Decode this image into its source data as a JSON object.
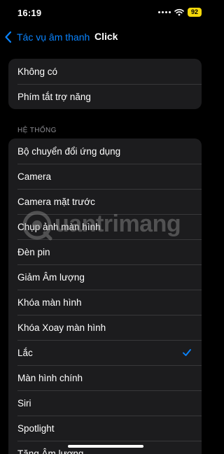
{
  "status_bar": {
    "time": "16:19",
    "battery": "92",
    "battery_color": "#f5d90a"
  },
  "nav": {
    "back_label": "Tác vụ âm thanh",
    "title": "Click",
    "accent_color": "#0a84ff"
  },
  "top_group": {
    "items": [
      {
        "label": "Không có"
      },
      {
        "label": "Phím tắt trợ năng"
      }
    ]
  },
  "system_section": {
    "header": "HỆ THỐNG",
    "items": [
      {
        "label": "Bộ chuyển đổi ứng dụng",
        "checked": false
      },
      {
        "label": "Camera",
        "checked": false
      },
      {
        "label": "Camera mặt trước",
        "checked": false
      },
      {
        "label": "Chụp ảnh màn hình",
        "checked": false
      },
      {
        "label": "Đèn pin",
        "checked": false
      },
      {
        "label": "Giảm Âm lượng",
        "checked": false
      },
      {
        "label": "Khóa màn hình",
        "checked": false
      },
      {
        "label": "Khóa Xoay màn hình",
        "checked": false
      },
      {
        "label": "Lắc",
        "checked": true
      },
      {
        "label": "Màn hình chính",
        "checked": false
      },
      {
        "label": "Siri",
        "checked": false
      },
      {
        "label": "Spotlight",
        "checked": false
      },
      {
        "label": "Tăng Âm lượng",
        "checked": false
      }
    ]
  },
  "watermark": {
    "text": "uantrimang",
    "icon": "quantrimang-logo-icon"
  }
}
